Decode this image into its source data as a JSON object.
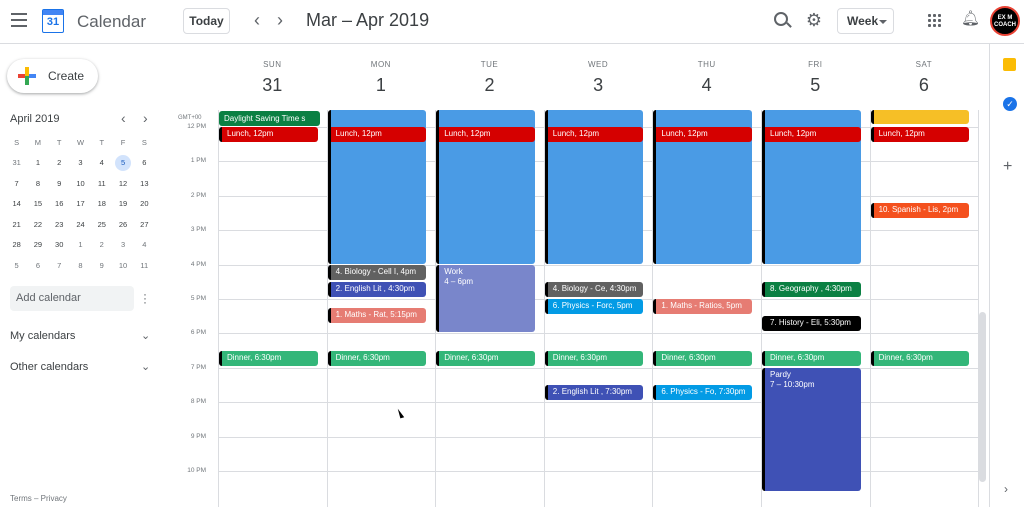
{
  "header": {
    "app_title": "Calendar",
    "logo_day": "31",
    "today_label": "Today",
    "prev_icon": "chevron-left-icon",
    "next_icon": "chevron-right-icon",
    "date_range": "Mar – Apr 2019",
    "view": "Week",
    "avatar_text": "EX M COACH"
  },
  "sidebar": {
    "create_label": "Create",
    "mini_month": "April 2019",
    "weekday_heads": [
      "S",
      "M",
      "T",
      "W",
      "T",
      "F",
      "S"
    ],
    "mini_weeks": [
      [
        "31",
        "1",
        "2",
        "3",
        "4",
        "5",
        "6"
      ],
      [
        "7",
        "8",
        "9",
        "10",
        "11",
        "12",
        "13"
      ],
      [
        "14",
        "15",
        "16",
        "17",
        "18",
        "19",
        "20"
      ],
      [
        "21",
        "22",
        "23",
        "24",
        "25",
        "26",
        "27"
      ],
      [
        "28",
        "29",
        "30",
        "1",
        "2",
        "3",
        "4"
      ],
      [
        "5",
        "6",
        "7",
        "8",
        "9",
        "10",
        "11"
      ]
    ],
    "selected_day": "5",
    "add_calendar_placeholder": "Add calendar",
    "my_calendars": "My calendars",
    "other_calendars": "Other calendars",
    "footer": "Terms – Privacy"
  },
  "grid": {
    "timezone": "GMT+00",
    "days": [
      {
        "name": "SUN",
        "num": "31"
      },
      {
        "name": "MON",
        "num": "1"
      },
      {
        "name": "TUE",
        "num": "2"
      },
      {
        "name": "WED",
        "num": "3"
      },
      {
        "name": "THU",
        "num": "4"
      },
      {
        "name": "FRI",
        "num": "5"
      },
      {
        "name": "SAT",
        "num": "6"
      }
    ],
    "hours": [
      "12 PM",
      "1 PM",
      "2 PM",
      "3 PM",
      "4 PM",
      "5 PM",
      "6 PM",
      "7 PM",
      "8 PM",
      "9 PM",
      "10 PM"
    ],
    "all_day_event": "Daylight Saving Time s"
  },
  "events": [
    {
      "day": 0,
      "start": 12.0,
      "end": 12.5,
      "title": "Lunch",
      "time": ", 12pm",
      "color": "#d50000"
    },
    {
      "day": 1,
      "start": 12.0,
      "end": 12.5,
      "title": "Lunch",
      "time": ", 12pm",
      "color": "#d50000"
    },
    {
      "day": 2,
      "start": 12.0,
      "end": 12.5,
      "title": "Lunch",
      "time": ", 12pm",
      "color": "#d50000"
    },
    {
      "day": 3,
      "start": 12.0,
      "end": 12.5,
      "title": "Lunch",
      "time": ", 12pm",
      "color": "#d50000"
    },
    {
      "day": 4,
      "start": 12.0,
      "end": 12.5,
      "title": "Lunch",
      "time": ", 12pm",
      "color": "#d50000"
    },
    {
      "day": 5,
      "start": 12.0,
      "end": 12.5,
      "title": "Lunch",
      "time": ", 12pm",
      "color": "#d50000"
    },
    {
      "day": 6,
      "start": 12.0,
      "end": 12.5,
      "title": "Lunch",
      "time": ", 12pm",
      "color": "#d50000"
    },
    {
      "day": 6,
      "start": 14.2,
      "end": 14.7,
      "title": "10. Spanish - Lis",
      "time": ", 2pm",
      "color": "#f4511e"
    },
    {
      "day": 1,
      "start": 16.0,
      "end": 16.5,
      "title": "4. Biology - Cell I",
      "time": ", 4pm",
      "color": "#616161"
    },
    {
      "day": 1,
      "start": 16.5,
      "end": 17.0,
      "title": "2. English Lit ",
      "time": ", 4:30pm",
      "color": "#3f51b5"
    },
    {
      "day": 1,
      "start": 17.25,
      "end": 17.75,
      "title": "1. Maths - Rat",
      "time": ", 5:15pm",
      "color": "#e67c73"
    },
    {
      "day": 3,
      "start": 16.5,
      "end": 17.0,
      "title": "4. Biology - Ce",
      "time": ", 4:30pm",
      "color": "#616161"
    },
    {
      "day": 3,
      "start": 17.0,
      "end": 17.5,
      "title": "6. Physics - Forc",
      "time": ", 5pm",
      "color": "#039be5"
    },
    {
      "day": 4,
      "start": 17.0,
      "end": 17.5,
      "title": "1. Maths - Ratios",
      "time": ", 5pm",
      "color": "#e67c73"
    },
    {
      "day": 5,
      "start": 16.5,
      "end": 17.0,
      "title": "8. Geography ",
      "time": ", 4:30pm",
      "color": "#0b8043"
    },
    {
      "day": 5,
      "start": 17.5,
      "end": 18.0,
      "title": "7. History - Eli",
      "time": ", 5:30pm",
      "color": "#000000"
    },
    {
      "day": 0,
      "start": 18.5,
      "end": 19.0,
      "title": "Dinner",
      "time": ", 6:30pm",
      "color": "#33b679"
    },
    {
      "day": 1,
      "start": 18.5,
      "end": 19.0,
      "title": "Dinner",
      "time": ", 6:30pm",
      "color": "#33b679"
    },
    {
      "day": 2,
      "start": 18.5,
      "end": 19.0,
      "title": "Dinner",
      "time": ", 6:30pm",
      "color": "#33b679"
    },
    {
      "day": 3,
      "start": 18.5,
      "end": 19.0,
      "title": "Dinner",
      "time": ", 6:30pm",
      "color": "#33b679"
    },
    {
      "day": 4,
      "start": 18.5,
      "end": 19.0,
      "title": "Dinner",
      "time": ", 6:30pm",
      "color": "#33b679"
    },
    {
      "day": 5,
      "start": 18.5,
      "end": 19.0,
      "title": "Dinner",
      "time": ", 6:30pm",
      "color": "#33b679"
    },
    {
      "day": 6,
      "start": 18.5,
      "end": 19.0,
      "title": "Dinner",
      "time": ", 6:30pm",
      "color": "#33b679"
    },
    {
      "day": 3,
      "start": 19.5,
      "end": 20.0,
      "title": "2. English Lit ",
      "time": ", 7:30pm",
      "color": "#3f51b5"
    },
    {
      "day": 4,
      "start": 19.5,
      "end": 20.0,
      "title": "6. Physics - Fo",
      "time": ", 7:30pm",
      "color": "#039be5"
    }
  ],
  "blocks": [
    {
      "day": 1,
      "start": 11.5,
      "end": 16.0,
      "color": "#4a9be5"
    },
    {
      "day": 2,
      "start": 11.5,
      "end": 16.0,
      "color": "#4a9be5"
    },
    {
      "day": 3,
      "start": 11.5,
      "end": 16.0,
      "color": "#4a9be5"
    },
    {
      "day": 4,
      "start": 11.5,
      "end": 16.0,
      "color": "#4a9be5"
    },
    {
      "day": 5,
      "start": 11.5,
      "end": 16.0,
      "color": "#4a9be5"
    },
    {
      "day": 6,
      "start": 11.5,
      "end": 11.95,
      "color": "#f6bf26"
    }
  ],
  "tall_events": [
    {
      "day": 2,
      "start": 16.0,
      "end": 18.0,
      "title": "Work",
      "time": "4 – 6pm",
      "color": "#7986cb"
    },
    {
      "day": 5,
      "start": 19.0,
      "end": 22.6,
      "title": "Pardy",
      "time": "7 – 10:30pm",
      "color": "#3f51b5"
    }
  ],
  "colors": {
    "accent": "#1a73e8",
    "selected_day_bg": "#d2e3fc"
  }
}
